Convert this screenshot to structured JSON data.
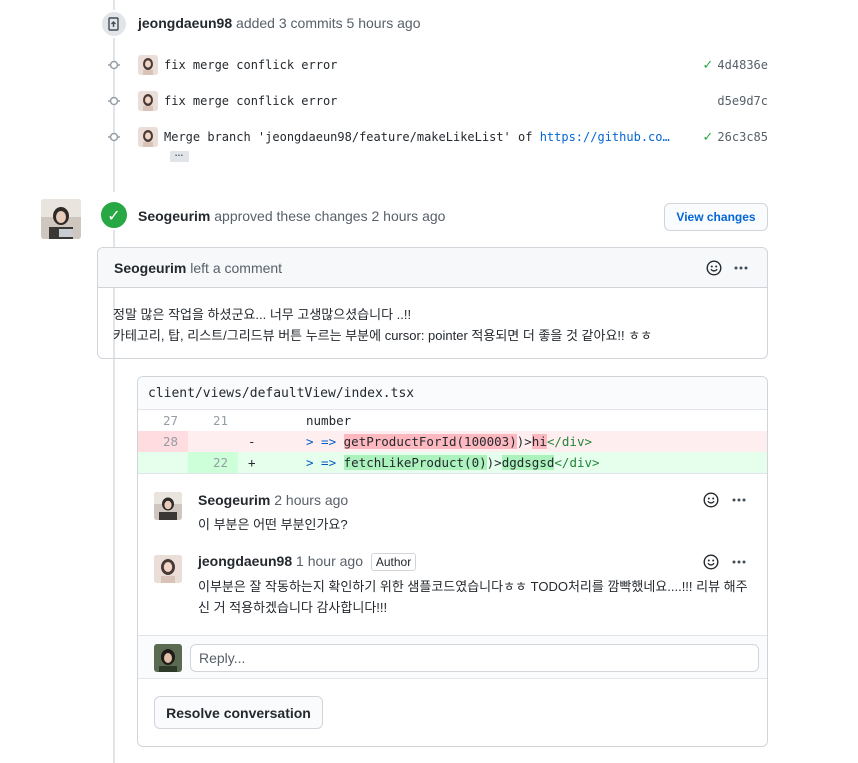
{
  "commits_event": {
    "actor": "jeongdaeun98",
    "action": "added 3 commits",
    "time": "5 hours ago",
    "commits": [
      {
        "message": "fix merge conflick error",
        "link": "",
        "sha": "4d4836e",
        "status": "success"
      },
      {
        "message": "fix merge conflick error",
        "link": "",
        "sha": "d5e9d7c",
        "status": "none"
      },
      {
        "message": "Merge branch 'jeongdaeun98/feature/makeLikeList' of ",
        "link": "https://github.co…",
        "sha": "26c3c85",
        "status": "success"
      }
    ],
    "ellipsis": "…"
  },
  "review": {
    "reviewer": "Seogeurim",
    "action": "approved these changes",
    "time": "2 hours ago",
    "view_changes_label": "View changes",
    "comment": {
      "author": "Seogeurim",
      "action": "left a comment",
      "body_line1": "정말 많은 작업을 하셨군요... 너무 고생많으셨습니다 ..!!",
      "body_line2": "카테고리, 탑, 리스트/그리드뷰 버튼 누르는 부분에 cursor: pointer 적용되면 더 좋을 것 같아요!! ㅎㅎ"
    }
  },
  "diff": {
    "file": "client/views/defaultView/index.tsx",
    "rows": [
      {
        "old": "27",
        "new": "21",
        "mark": "",
        "code": "number"
      },
      {
        "old": "28",
        "new": "",
        "mark": "-",
        "arrow": "> =>",
        "fn": "getProductForId(100003)",
        "mid": ")>",
        "hl": "hi",
        "close": "</div>"
      },
      {
        "old": "",
        "new": "22",
        "mark": "+",
        "arrow": "> =>",
        "fn": "fetchLikeProduct(0)",
        "mid": ")>",
        "hl": "dgdsgsd",
        "close": "</div>"
      }
    ]
  },
  "thread": {
    "comments": [
      {
        "author": "Seogeurim",
        "time": "2 hours ago",
        "badge": "",
        "body": "이 부분은 어떤 부분인가요?"
      },
      {
        "author": "jeongdaeun98",
        "time": "1 hour ago",
        "badge": "Author",
        "body": "이부분은 잘 작동하는지 확인하기 위한 샘플코드였습니다ㅎㅎ TODO처리를 깜빡했네요....!!! 리뷰 해주신 거 적용하겠습니다 감사합니다!!!"
      }
    ],
    "reply_placeholder": "Reply...",
    "resolve_label": "Resolve conversation"
  },
  "colors": {
    "success": "#28a745",
    "link": "#0366d6",
    "deleted_bg": "#ffeef0",
    "added_bg": "#e6ffed"
  }
}
